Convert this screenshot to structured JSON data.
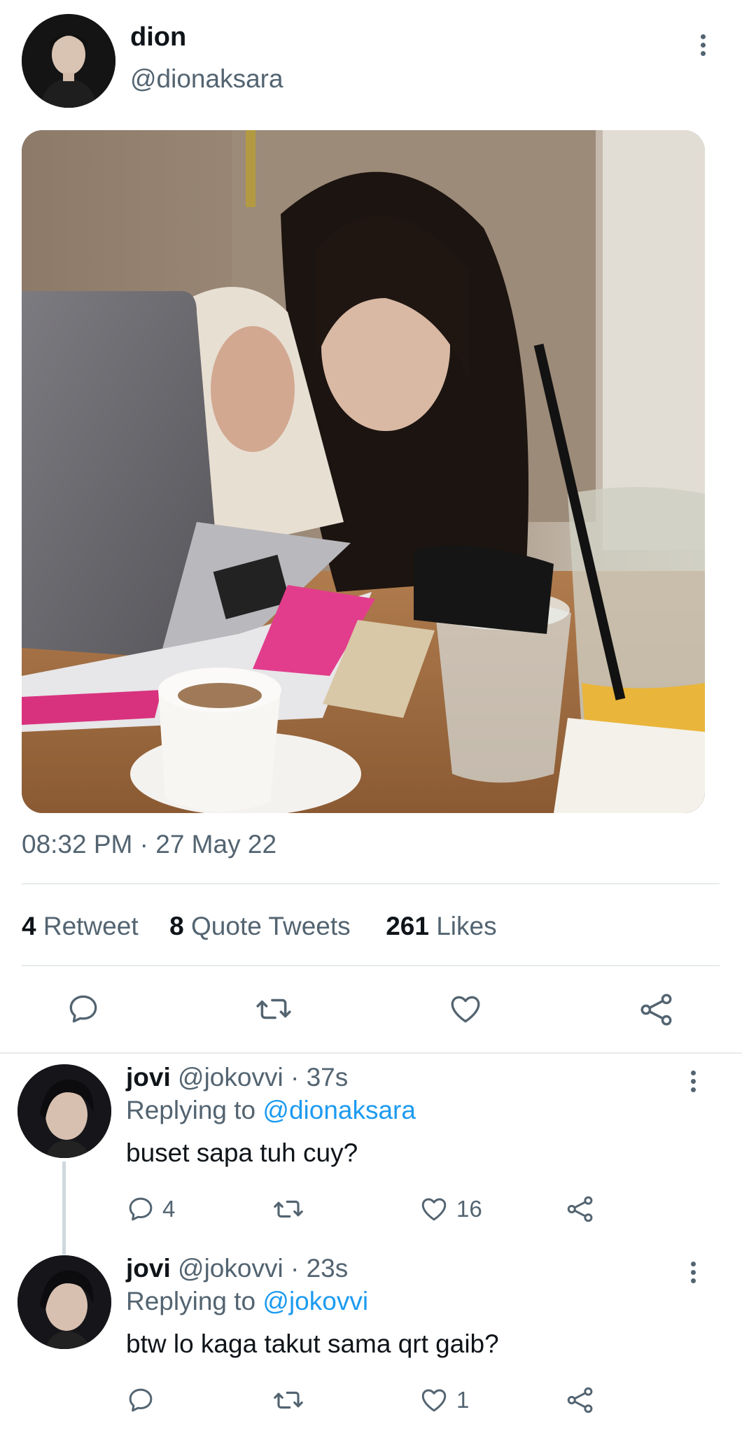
{
  "tweet": {
    "display_name": "dion",
    "handle": "@dionaksara",
    "timestamp": "08:32 PM · 27 May 22",
    "stats": {
      "retweets_count": "4",
      "retweets_label": "Retweet",
      "quotes_count": "8",
      "quotes_label": "Quote Tweets",
      "likes_count": "261",
      "likes_label": "Likes"
    },
    "action_icons": [
      "reply-icon",
      "retweet-icon",
      "like-icon",
      "share-icon"
    ]
  },
  "replies": [
    {
      "display_name": "jovi",
      "handle": "@jokovvi",
      "time": "· 37s",
      "replying_label": "Replying to",
      "replying_to": "@dionaksara",
      "text": "buset sapa tuh cuy?",
      "reply_count": "4",
      "retweet_count": "",
      "like_count": "16"
    },
    {
      "display_name": "jovi",
      "handle": "@jokovvi",
      "time": "· 23s",
      "replying_label": "Replying to",
      "replying_to": "@jokovvi",
      "text": "btw lo kaga takut sama qrt gaib?",
      "reply_count": "",
      "retweet_count": "",
      "like_count": "1"
    }
  ],
  "colors": {
    "accent": "#1d9bf0",
    "muted_text": "#536471",
    "text": "#0f1419",
    "divider": "#e8ebed"
  }
}
